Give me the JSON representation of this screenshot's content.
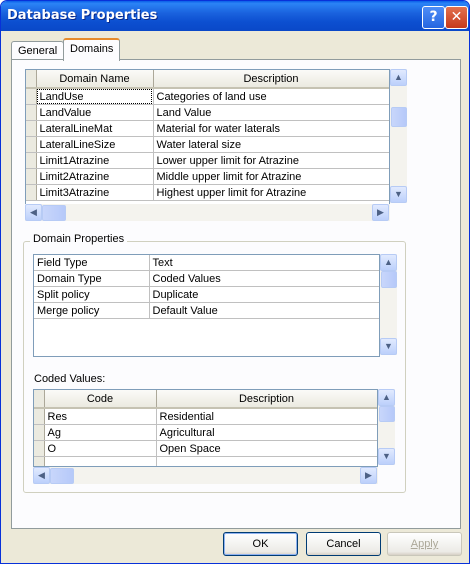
{
  "window": {
    "title": "Database Properties"
  },
  "title_buttons": {
    "help": "?",
    "close": "✕"
  },
  "tabs": [
    {
      "label": "General"
    },
    {
      "label": "Domains"
    }
  ],
  "domains_grid": {
    "headers": [
      "Domain Name",
      "Description"
    ],
    "rows": [
      [
        "LandUse",
        "Categories of land use"
      ],
      [
        "LandValue",
        "Land Value"
      ],
      [
        "LateralLineMat",
        "Material for water laterals"
      ],
      [
        "LateralLineSize",
        "Water lateral size"
      ],
      [
        "Limit1Atrazine",
        "Lower upper limit for Atrazine"
      ],
      [
        "Limit2Atrazine",
        "Middle upper limit for Atrazine"
      ],
      [
        "Limit3Atrazine",
        "Highest upper limit for Atrazine"
      ]
    ]
  },
  "domain_properties": {
    "label": "Domain Properties",
    "rows": [
      [
        "Field Type",
        "Text"
      ],
      [
        "Domain Type",
        "Coded Values"
      ],
      [
        "Split policy",
        "Duplicate"
      ],
      [
        "Merge policy",
        "Default Value"
      ]
    ]
  },
  "coded_values": {
    "label": "Coded Values:",
    "headers": [
      "Code",
      "Description"
    ],
    "rows": [
      [
        "Res",
        "Residential"
      ],
      [
        "Ag",
        "Agricultural"
      ],
      [
        "O",
        "Open Space"
      ],
      [
        "",
        ""
      ]
    ]
  },
  "buttons": {
    "ok": "OK",
    "cancel": "Cancel",
    "apply": "Apply"
  },
  "scroll_glyphs": {
    "up": "▲",
    "down": "▼",
    "left": "◀",
    "right": "▶"
  },
  "colors": {
    "title_bar": "#0a48c8",
    "dialog_bg": "#ece9d8",
    "tab_highlight": "#e68b2c"
  }
}
